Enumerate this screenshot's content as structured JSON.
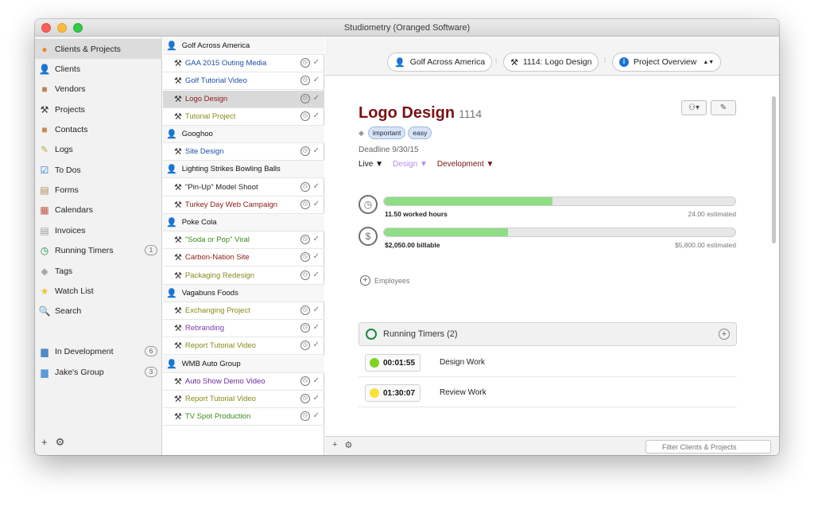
{
  "window": {
    "title": "Studiometry (Oranged Software)"
  },
  "colors": {
    "accent_title": "#7a1216",
    "progress_fill": "#8fdd84",
    "design_status": "#b48cf0",
    "timer_green": "#1a8a3a"
  },
  "sidebar": {
    "items": [
      {
        "label": "Clients & Projects",
        "icon": "clients-projects-icon",
        "glyph": "●",
        "color": "#e88b2f",
        "selected": true
      },
      {
        "label": "Clients",
        "icon": "person-icon",
        "glyph": "👤",
        "color": "#111"
      },
      {
        "label": "Vendors",
        "icon": "vendor-icon",
        "glyph": "■",
        "color": "#b9855a"
      },
      {
        "label": "Projects",
        "icon": "hammer-icon",
        "glyph": "⚒",
        "color": "#333"
      },
      {
        "label": "Contacts",
        "icon": "contacts-icon",
        "glyph": "■",
        "color": "#c8894f"
      },
      {
        "label": "Logs",
        "icon": "logs-icon",
        "glyph": "✎",
        "color": "#c7a64b"
      },
      {
        "label": "To Dos",
        "icon": "checkbox-icon",
        "glyph": "☑",
        "color": "#1f73d8"
      },
      {
        "label": "Forms",
        "icon": "forms-icon",
        "glyph": "▤",
        "color": "#b38e55"
      },
      {
        "label": "Calendars",
        "icon": "calendar-icon",
        "glyph": "▦",
        "color": "#c4564b"
      },
      {
        "label": "Invoices",
        "icon": "invoice-icon",
        "glyph": "▤",
        "color": "#9d9d9d"
      },
      {
        "label": "Running Timers",
        "icon": "timer-icon",
        "glyph": "◷",
        "color": "#1a8a3a",
        "badge": "1"
      },
      {
        "label": "Tags",
        "icon": "tags-icon",
        "glyph": "◆",
        "color": "#aaaaaa"
      },
      {
        "label": "Watch List",
        "icon": "star-icon",
        "glyph": "★",
        "color": "#f2c230"
      },
      {
        "label": "Search",
        "icon": "magnifier-icon",
        "glyph": "🔍",
        "color": "#555"
      },
      {
        "label": "In Development",
        "icon": "folder-icon",
        "glyph": "▆",
        "color": "#4f8ac4",
        "badge": "6"
      },
      {
        "label": "Jake's Group",
        "icon": "folder-icon",
        "glyph": "▆",
        "color": "#5d9ad8",
        "badge": "3"
      }
    ],
    "footer": {
      "add": "+",
      "settings": "⚙"
    }
  },
  "project_list": [
    {
      "type": "client",
      "label": "Golf Across America"
    },
    {
      "type": "project",
      "label": "GAA 2015 Outing Media",
      "color": "#1f4fa8"
    },
    {
      "type": "project",
      "label": "Golf Tutorial Video",
      "color": "#1f4fa8"
    },
    {
      "type": "project",
      "label": "Logo Design",
      "color": "#8b1a1a",
      "selected": true
    },
    {
      "type": "project",
      "label": "Tutorial Project",
      "color": "#8a8a1a"
    },
    {
      "type": "client",
      "label": "Googhoo"
    },
    {
      "type": "project",
      "label": "Site Design",
      "color": "#1f4fa8"
    },
    {
      "type": "client",
      "label": "Lighting Strikes Bowling Balls"
    },
    {
      "type": "project",
      "label": "\"Pin-Up\" Model Shoot",
      "color": "#222222"
    },
    {
      "type": "project",
      "label": "Turkey Day Web Campaign",
      "color": "#8b1a1a"
    },
    {
      "type": "client",
      "label": "Poke Cola"
    },
    {
      "type": "project",
      "label": "\"Soda or Pop\" Viral",
      "color": "#3a8a1a"
    },
    {
      "type": "project",
      "label": "Carbon-Nation Site",
      "color": "#8b1a1a"
    },
    {
      "type": "project",
      "label": "Packaging Redesign",
      "color": "#8a8a1a"
    },
    {
      "type": "client",
      "label": "Vagabuns Foods"
    },
    {
      "type": "project",
      "label": "Exchanging Project",
      "color": "#8a8a1a"
    },
    {
      "type": "project",
      "label": "Rebranding",
      "color": "#7a3aa8"
    },
    {
      "type": "project",
      "label": "Report Tutorial Video",
      "color": "#8a8a1a"
    },
    {
      "type": "client",
      "label": "WMB Auto Group"
    },
    {
      "type": "project",
      "label": "Auto Show Demo Video",
      "color": "#6a2a9a"
    },
    {
      "type": "project",
      "label": "Report Tutorial Video",
      "color": "#8a8a1a"
    },
    {
      "type": "project",
      "label": "TV Spot Production",
      "color": "#3a8a1a"
    }
  ],
  "breadcrumb": {
    "client": "Golf Across America",
    "project": "1114: Logo Design",
    "view": "Project Overview",
    "view_arrow": "▲▼"
  },
  "project": {
    "title": "Logo Design",
    "number": "1114",
    "tags": [
      "important",
      "easy"
    ],
    "deadline": "Deadline 9/30/15",
    "statuses": [
      "Live ▼",
      "Design ▼",
      "Development ▼"
    ],
    "hours": {
      "label": "11.50 worked hours",
      "estimate": "24.00 estimated",
      "fraction": 0.479
    },
    "billable": {
      "label": "$2,050.00 billable",
      "estimate": "$5,800.00 estimated",
      "fraction": 0.353
    },
    "employees_label": "Employees"
  },
  "running_timers": {
    "header": "Running Timers (2)",
    "rows": [
      {
        "time": "00:01:55",
        "name": "Design Work",
        "dot": "#7ed321"
      },
      {
        "time": "01:30:07",
        "name": "Review Work",
        "dot": "#f8e33c"
      }
    ]
  },
  "bottom": {
    "filter_placeholder": "Filter Clients & Projects"
  }
}
